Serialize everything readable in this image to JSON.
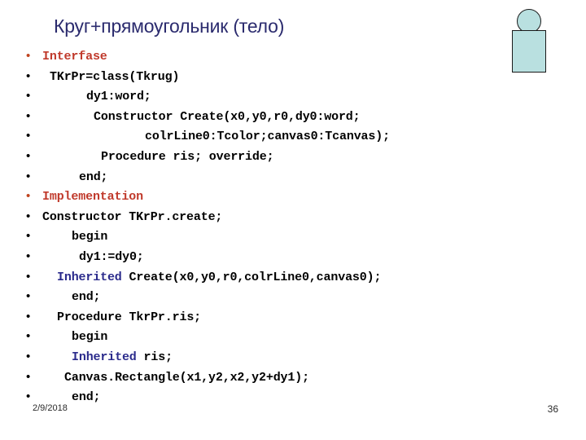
{
  "slide": {
    "title": "Круг+прямоугольник (тело)",
    "title_color": "#2b2b6e",
    "background_color": "#ffffff"
  },
  "figure": {
    "name": "circle-over-rectangle",
    "fill_color": "#b9e0e0",
    "stroke_color": "#1a1a1a"
  },
  "code": {
    "bullet_glyph": "•",
    "accent_bullet_color": "#c0441f",
    "keyword_red": "#c0392b",
    "keyword_blue": "#2b2b8c",
    "lines": [
      {
        "bullet": "•",
        "bullet_accent": true,
        "indent": 0,
        "text": "Interfase",
        "style": "kw-red"
      },
      {
        "bullet": "•",
        "bullet_accent": false,
        "indent": 1,
        "text": "TKrPr=class(Tkrug)",
        "style": ""
      },
      {
        "bullet": "•",
        "bullet_accent": false,
        "indent": 6,
        "text": "dy1:word;",
        "style": ""
      },
      {
        "bullet": "•",
        "bullet_accent": false,
        "indent": 7,
        "text": "Constructor Create(x0,y0,r0,dy0:word;",
        "style": ""
      },
      {
        "bullet": "•",
        "bullet_accent": false,
        "indent": 14,
        "text": "colrLine0:Tcolor;canvas0:Tcanvas);",
        "style": ""
      },
      {
        "bullet": "•",
        "bullet_accent": false,
        "indent": 8,
        "text": "Procedure ris; override;",
        "style": ""
      },
      {
        "bullet": "•",
        "bullet_accent": false,
        "indent": 5,
        "text": "end;",
        "style": ""
      },
      {
        "bullet": "•",
        "bullet_accent": true,
        "indent": 0,
        "text": "Implementation",
        "style": "kw-red"
      },
      {
        "bullet": "•",
        "bullet_accent": false,
        "indent": 0,
        "text": "Constructor TKrPr.create;",
        "style": ""
      },
      {
        "bullet": "•",
        "bullet_accent": false,
        "indent": 4,
        "text": "begin",
        "style": ""
      },
      {
        "bullet": "•",
        "bullet_accent": false,
        "indent": 5,
        "text": "dy1:=dy0;",
        "style": ""
      },
      {
        "bullet": "•",
        "bullet_accent": false,
        "indent": 2,
        "text": "Inherited Create(x0,y0,r0,colrLine0,canvas0);",
        "style": "kw-blue-lead",
        "lead": "Inherited",
        "rest": " Create(x0,y0,r0,colrLine0,canvas0);"
      },
      {
        "bullet": "•",
        "bullet_accent": false,
        "indent": 4,
        "text": "end;",
        "style": ""
      },
      {
        "bullet": "•",
        "bullet_accent": false,
        "indent": 2,
        "text": "Procedure TkrPr.ris;",
        "style": ""
      },
      {
        "bullet": "•",
        "bullet_accent": false,
        "indent": 4,
        "text": "begin",
        "style": ""
      },
      {
        "bullet": "•",
        "bullet_accent": false,
        "indent": 4,
        "text": "Inherited ris;",
        "style": "kw-blue-lead",
        "lead": "Inherited",
        "rest": " ris;"
      },
      {
        "bullet": "•",
        "bullet_accent": false,
        "indent": 3,
        "text": "Canvas.Rectangle(x1,y2,x2,y2+dy1);",
        "style": ""
      },
      {
        "bullet": "•",
        "bullet_accent": false,
        "indent": 4,
        "text": "end;",
        "style": ""
      }
    ]
  },
  "footer": {
    "date": "2/9/2018",
    "page_number": "36"
  }
}
